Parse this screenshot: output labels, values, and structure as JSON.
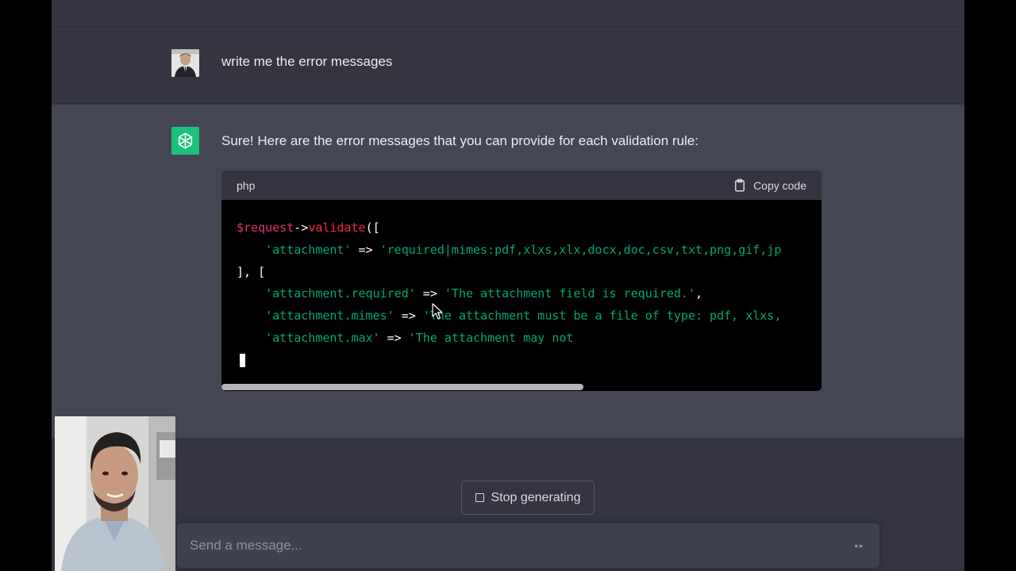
{
  "conversation": {
    "user_message": "write me the error messages",
    "assistant_intro": "Sure! Here are the error messages that you can provide for each validation rule:"
  },
  "code_block": {
    "language": "php",
    "copy_label": "Copy code",
    "lines": [
      [
        {
          "t": "$request",
          "c": "var"
        },
        {
          "t": "->",
          "c": "plain"
        },
        {
          "t": "validate",
          "c": "fn"
        },
        {
          "t": "([",
          "c": "plain"
        }
      ],
      [
        {
          "t": "    ",
          "c": "plain"
        },
        {
          "t": "'attachment'",
          "c": "str"
        },
        {
          "t": " => ",
          "c": "plain"
        },
        {
          "t": "'required|mimes:pdf,xlxs,xlx,docx,doc,csv,txt,png,gif,jp",
          "c": "str"
        }
      ],
      [
        {
          "t": "], [",
          "c": "plain"
        }
      ],
      [
        {
          "t": "    ",
          "c": "plain"
        },
        {
          "t": "'attachment.required'",
          "c": "str"
        },
        {
          "t": " => ",
          "c": "plain"
        },
        {
          "t": "'The attachment field is required.'",
          "c": "str"
        },
        {
          "t": ",",
          "c": "plain"
        }
      ],
      [
        {
          "t": "    ",
          "c": "plain"
        },
        {
          "t": "'attachment.mimes'",
          "c": "str"
        },
        {
          "t": " => ",
          "c": "plain"
        },
        {
          "t": "'The attachment must be a file of type: pdf, xlxs,",
          "c": "str"
        }
      ],
      [
        {
          "t": "    ",
          "c": "plain"
        },
        {
          "t": "'attachment.max'",
          "c": "str"
        },
        {
          "t": " => ",
          "c": "plain"
        },
        {
          "t": "'The attachment may not",
          "c": "str"
        }
      ]
    ],
    "scroll_position": 0.6
  },
  "controls": {
    "stop_label": "Stop generating",
    "input_placeholder": "Send a message...",
    "input_value": ""
  },
  "colors": {
    "background": "#343541",
    "assistant_background": "#444654",
    "accent_green": "#19c37d",
    "code_string": "#00a67d",
    "code_variable": "#df3079",
    "code_function": "#f22c3d"
  },
  "icons": {
    "user_avatar": "user-avatar-photo",
    "assistant_avatar": "openai-logo-icon",
    "copy": "clipboard-icon",
    "stop": "stop-square-icon",
    "send": "dots-icon",
    "pointer": "mouse-pointer-icon"
  }
}
